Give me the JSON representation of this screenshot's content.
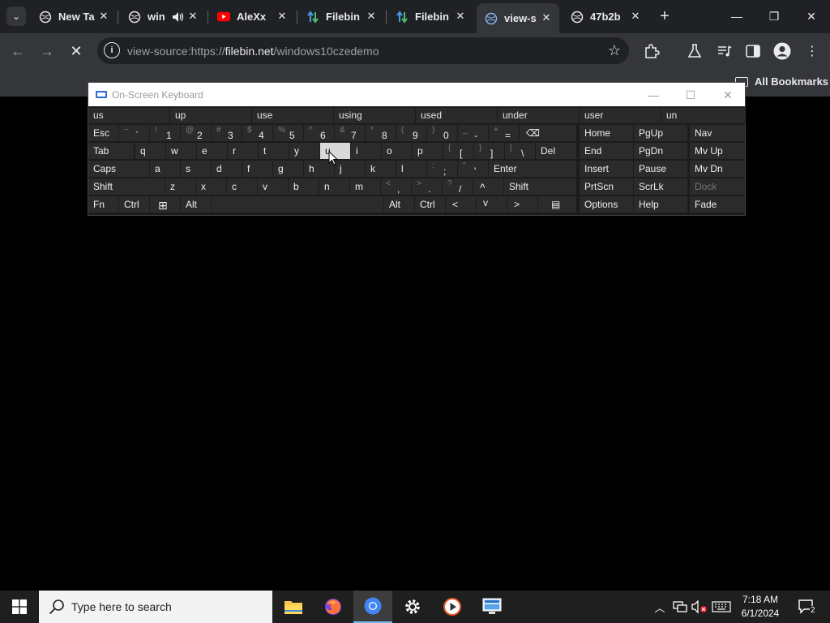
{
  "browser": {
    "tabs": [
      {
        "label": "New Ta",
        "icon": "globe-icon"
      },
      {
        "label": "win",
        "icon": "globe-icon",
        "audio": "speaker-icon"
      },
      {
        "label": "AleXx",
        "icon": "youtube-icon"
      },
      {
        "label": "Filebin",
        "icon": "filebin-icon"
      },
      {
        "label": "Filebin",
        "icon": "filebin-icon"
      },
      {
        "label": "view-s",
        "icon": "globe-icon"
      },
      {
        "label": "47b2b",
        "icon": "globe-icon"
      }
    ],
    "active_tab_index": 5,
    "address": {
      "prefix": "view-source:https://",
      "domain": "filebin.net",
      "path": "/windows10czedemo"
    },
    "bookmarks_label": "All Bookmarks"
  },
  "osk": {
    "title": "On-Screen Keyboard",
    "suggestions": [
      "us",
      "up",
      "use",
      "using",
      "used",
      "under",
      "user",
      "un"
    ],
    "rows": [
      [
        {
          "m": "Esc"
        },
        {
          "s": "~",
          "p": "`"
        },
        {
          "s": "!",
          "p": "1"
        },
        {
          "s": "@",
          "p": "2"
        },
        {
          "s": "#",
          "p": "3"
        },
        {
          "s": "$",
          "p": "4"
        },
        {
          "s": "%",
          "p": "5"
        },
        {
          "s": "^",
          "p": "6"
        },
        {
          "s": "&",
          "p": "7"
        },
        {
          "s": "*",
          "p": "8"
        },
        {
          "s": "(",
          "p": "9"
        },
        {
          "s": ")",
          "p": "0"
        },
        {
          "s": "_",
          "p": "-"
        },
        {
          "s": "+",
          "p": "="
        },
        {
          "m": "⌫"
        },
        {
          "m": "Home"
        },
        {
          "m": "PgUp"
        },
        {
          "m": "Nav"
        }
      ],
      [
        {
          "m": "Tab"
        },
        {
          "m": "q"
        },
        {
          "m": "w"
        },
        {
          "m": "e"
        },
        {
          "m": "r"
        },
        {
          "m": "t"
        },
        {
          "m": "y"
        },
        {
          "m": "u"
        },
        {
          "m": "i"
        },
        {
          "m": "o"
        },
        {
          "m": "p"
        },
        {
          "s": "{",
          "p": "["
        },
        {
          "s": "}",
          "p": "]"
        },
        {
          "s": "|",
          "p": "\\"
        },
        {
          "m": "Del"
        },
        {
          "m": "End"
        },
        {
          "m": "PgDn"
        },
        {
          "m": "Mv Up"
        }
      ],
      [
        {
          "m": "Caps"
        },
        {
          "m": "a"
        },
        {
          "m": "s"
        },
        {
          "m": "d"
        },
        {
          "m": "f"
        },
        {
          "m": "g"
        },
        {
          "m": "h"
        },
        {
          "m": "j"
        },
        {
          "m": "k"
        },
        {
          "m": "l"
        },
        {
          "s": ":",
          "p": ";"
        },
        {
          "s": "\"",
          "p": "'"
        },
        {
          "m": "Enter"
        },
        {
          "m": "Insert"
        },
        {
          "m": "Pause"
        },
        {
          "m": "Mv Dn"
        }
      ],
      [
        {
          "m": "Shift"
        },
        {
          "m": "z"
        },
        {
          "m": "x"
        },
        {
          "m": "c"
        },
        {
          "m": "v"
        },
        {
          "m": "b"
        },
        {
          "m": "n"
        },
        {
          "m": "m"
        },
        {
          "s": "<",
          "p": ","
        },
        {
          "s": ">",
          "p": "."
        },
        {
          "s": "?",
          "p": "/"
        },
        {
          "m": "^"
        },
        {
          "m": "Shift"
        },
        {
          "m": "PrtScn"
        },
        {
          "m": "ScrLk"
        },
        {
          "m": "Dock"
        }
      ],
      [
        {
          "m": "Fn"
        },
        {
          "m": "Ctrl"
        },
        {
          "m": "⊞"
        },
        {
          "m": "Alt"
        },
        {
          "m": ""
        },
        {
          "m": "Alt"
        },
        {
          "m": "Ctrl"
        },
        {
          "m": "<"
        },
        {
          "m": "v"
        },
        {
          "m": ">"
        },
        {
          "m": "▤"
        },
        {
          "m": "Options"
        },
        {
          "m": "Help"
        },
        {
          "m": "Fade"
        }
      ]
    ],
    "highlighted_key": "u",
    "disabled_key": "Dock"
  },
  "taskbar": {
    "search_placeholder": "Type here to search",
    "apps": [
      "file-explorer-icon",
      "firefox-icon",
      "chrome-icon",
      "settings-icon",
      "media-player-icon",
      "remote-desktop-icon"
    ],
    "active_app": "chrome-icon",
    "time": "7:18 AM",
    "date": "6/1/2024",
    "notification_count": "2"
  },
  "colors": {
    "chrome_dark": "#202124",
    "chrome_toolbar": "#35363a",
    "osk_key": "#2b2b2b",
    "osk_highlight": "#d9d9d9",
    "taskbar": "#1f1f1f"
  }
}
